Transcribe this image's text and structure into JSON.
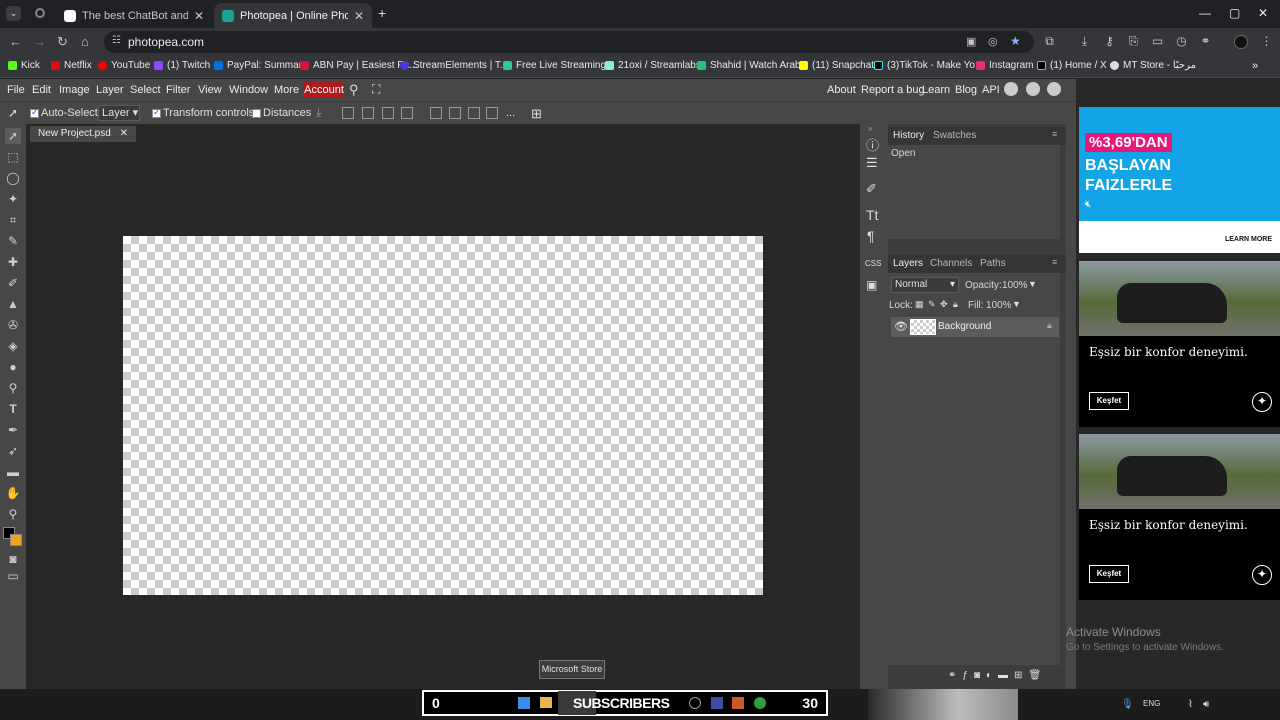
{
  "browser": {
    "tabs": [
      {
        "title": "The best ChatBot and Widgets",
        "active": false
      },
      {
        "title": "Photopea | Online Photo Editor",
        "active": true
      }
    ],
    "url": "photopea.com",
    "bookmarks": [
      "Kick",
      "Netflix",
      "YouTube",
      "(1) Twitch",
      "PayPal: Summary",
      "ABN Pay | Easiest Pa...",
      "StreamElements | T...",
      "Free Live Streaming...",
      "21oxi / Streamlabs",
      "Shahid | Watch Arab...",
      "(11) Snapchat",
      "(3)TikTok - Make Yo...",
      "Instagram",
      "(1) Home / X",
      "MT Store - مرحبًا"
    ]
  },
  "photopea": {
    "menu": [
      "File",
      "Edit",
      "Image",
      "Layer",
      "Select",
      "Filter",
      "View",
      "Window",
      "More"
    ],
    "account": "Account",
    "right_menu": [
      "About",
      "Report a bug",
      "Learn",
      "Blog",
      "API"
    ],
    "options": {
      "auto_select": "Auto-Select",
      "layer_mode": "Layer",
      "transform": "Transform controls",
      "distances": "Distances"
    },
    "doc_tab": "New Project.psd",
    "history": {
      "tabs": [
        "History",
        "Swatches"
      ],
      "items": [
        "Open"
      ]
    },
    "layers": {
      "tabs": [
        "Layers",
        "Channels",
        "Paths"
      ],
      "blend": "Normal",
      "opacity_label": "Opacity:",
      "opacity": "100%",
      "lock_label": "Lock:",
      "fill_label": "Fill:",
      "fill": "100%",
      "items": [
        "Background"
      ]
    },
    "tooltip": "Microsoft Store"
  },
  "ads": {
    "ad1": {
      "badge": "%3,69'DAN",
      "line2": "BAŞLAYAN",
      "line3": "FAIZLERLE",
      "cta": "LEARN MORE"
    },
    "ad2": {
      "text": "Eşsiz bir konfor deneyimi.",
      "cta": "Keşfet"
    },
    "ad3": {
      "text": "Eşsiz bir konfor deneyimi.",
      "cta": "Keşfet"
    }
  },
  "watermark": {
    "line1": "Activate Windows",
    "line2": "Go to Settings to activate Windows."
  },
  "taskbar": {
    "count_left": "0",
    "label": "SUBSCRIBERS",
    "count_right": "30",
    "lang": "ENG"
  }
}
